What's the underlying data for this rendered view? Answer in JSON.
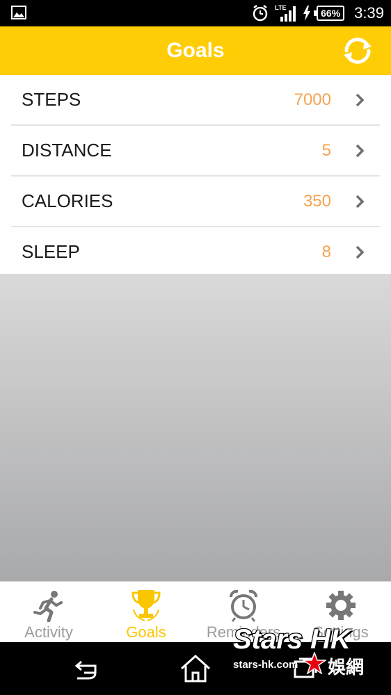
{
  "status_bar": {
    "network": "LTE",
    "battery": "66%",
    "time": "3:39",
    "icons": [
      "image-icon",
      "alarm-icon",
      "signal-icon",
      "charging-icon",
      "battery-icon"
    ]
  },
  "header": {
    "title": "Goals",
    "accent": "#ffcd05",
    "sync_icon": "sync-icon"
  },
  "goals": [
    {
      "label": "STEPS",
      "value": "7000"
    },
    {
      "label": "DISTANCE",
      "value": "5"
    },
    {
      "label": "CALORIES",
      "value": "350"
    },
    {
      "label": "SLEEP",
      "value": "8"
    }
  ],
  "tabs": [
    {
      "label": "Activity",
      "icon": "runner-icon",
      "active": false
    },
    {
      "label": "Goals",
      "icon": "trophy-icon",
      "active": true
    },
    {
      "label": "Reminders",
      "icon": "alarm-clock-icon",
      "active": false
    },
    {
      "label": "Settings",
      "icon": "gear-icon",
      "active": false
    }
  ],
  "nav_bar": {
    "icons": [
      "back-icon",
      "home-icon",
      "recents-icon"
    ]
  },
  "watermark": {
    "title": "Stars HK",
    "url": "stars-hk.com",
    "cjk": "娛網"
  },
  "colors": {
    "value_orange": "#f6a350",
    "tab_active": "#f9c600",
    "tab_inactive": "#9c9c9c"
  }
}
